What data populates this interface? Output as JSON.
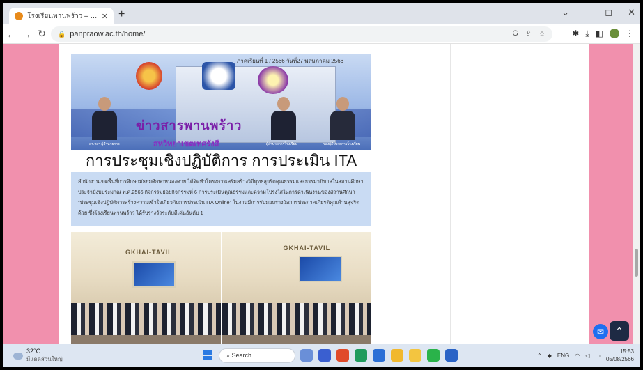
{
  "browser": {
    "tab_title": "โรงเรียนพานพร้าว – ออกานั่ งนอนลี ...",
    "url": "panpraow.ac.th/home/"
  },
  "banner": {
    "date": "ภาคเรียนที่ 1  /  2566   วันที่27 พฤษภาคม 2566",
    "big_text": "ข่าวสารพานพร้าว",
    "sub_text": "สหวิทยาเขตเทศรังสี",
    "caption1": "ดร.ฯลฯ ผู้อำนวยการ",
    "caption2": "ผู้อำนวยการโรงเรียน",
    "caption3": "รองผู้อำนวยการโรงเรียน"
  },
  "post": {
    "title": "การประชุมเชิงปฏิบัติการ การประเมิน ITA",
    "body": "สำนักงานเขตพื้นที่การศึกษามัธยมศึกษาหนองคาย ได้จัดทำโครงการเสริมสร้างวิถีพุทธสุจริตคุณธรรมและธรรมาภิบาลในสถานศึกษา ประจำปีงบประมาณ พ.ศ.2566 กิจกรรมย่อยกิจกรรมที่ 6 การประเมินคุณธรรมและความโปร่งใสในการดำเนินงานของสถานศึกษา \"ประชุมเชิงปฏิบัติการสร้างความเข้าใจเกี่ยวกับการประเมิน ITA Online\" ในงานมีการรับมอบรางวัลการประกาศเกียรติคุณด้านสุจริตด้วย ซึ่งโรงเรียนพานพร้าว ได้รับรางวัลระดับดีเด่นอันดับ 1",
    "photo_sign": "GKHAI-TAVIL"
  },
  "taskbar": {
    "temp": "32°C",
    "weather": "มีแดดส่วนใหญ่",
    "search_label": "Search",
    "lang": "ENG",
    "time": "15:53",
    "date": "05/08/2566"
  }
}
